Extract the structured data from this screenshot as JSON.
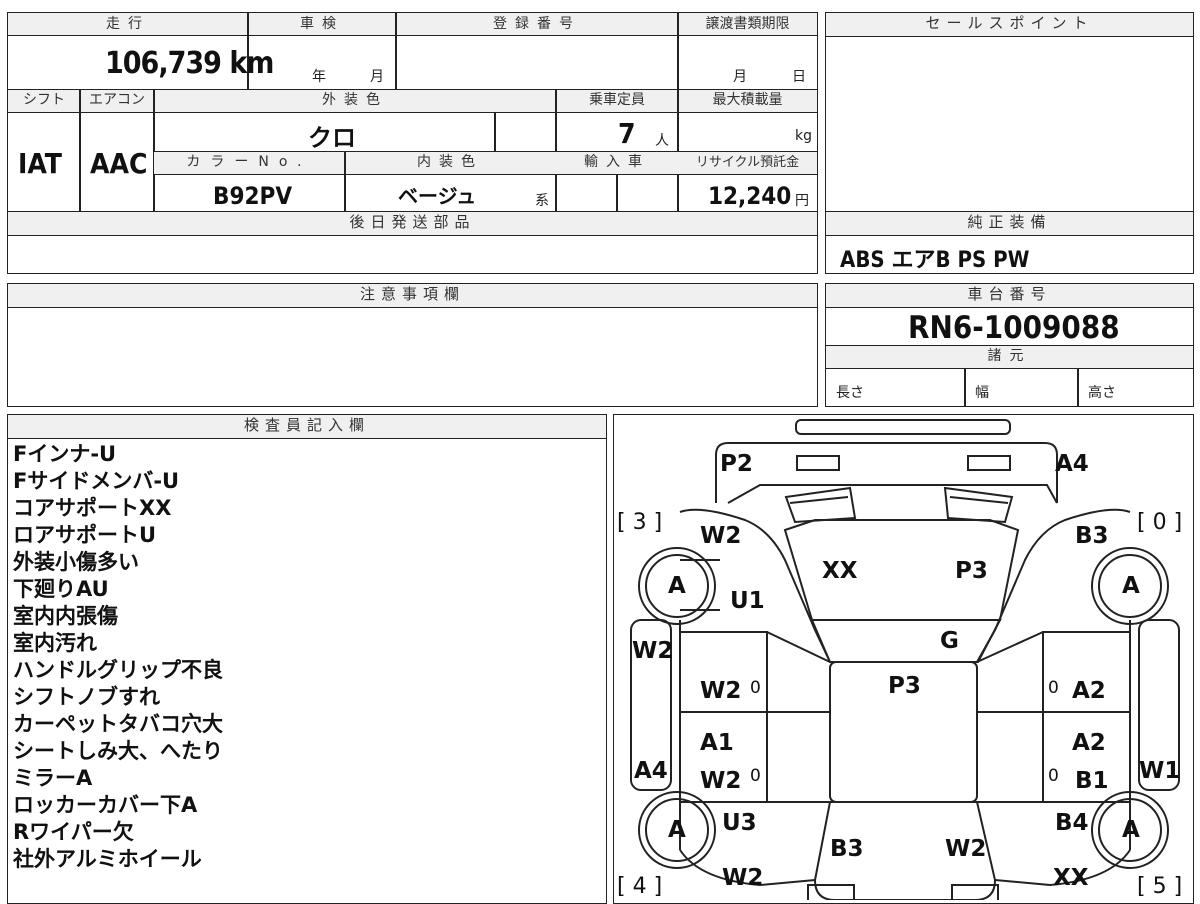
{
  "vehicle_info": {
    "mileage_header": "走行",
    "mileage_value": "106,739 km",
    "shaken_header": "車検",
    "shaken_year": "年",
    "shaken_month": "月",
    "registration_header": "登録番号",
    "transfer_deadline_header": "譲渡書類期限",
    "transfer_month": "月",
    "transfer_day": "日",
    "shift_header": "シフト",
    "shift_value": "IAT",
    "aircon_header": "エアコン",
    "aircon_value": "AAC",
    "exterior_color_header": "外装色",
    "exterior_color_value": "クロ",
    "capacity_header": "乗車定員",
    "capacity_value": "7",
    "capacity_unit": "人",
    "max_load_header": "最大積載量",
    "max_load_unit": "kg",
    "color_no_header": "カラーNo.",
    "color_no_value": "B92PV",
    "interior_color_header": "内装色",
    "interior_color_value": "ベージュ",
    "interior_color_suffix": "系",
    "import_header": "輸入車",
    "recycle_header": "リサイクル預託金",
    "recycle_value": "12,240",
    "recycle_unit": "円",
    "later_parts_header": "後日発送部品"
  },
  "sales_point": {
    "header": "セールスポイント"
  },
  "genuine_equipment": {
    "header": "純正装備",
    "value": "ABS エアB PS PW"
  },
  "notes": {
    "header": "注意事項欄"
  },
  "chassis": {
    "header": "車台番号",
    "value": "RN6-1009088"
  },
  "specs": {
    "header": "諸元",
    "length": "長さ",
    "width": "幅",
    "height": "高さ"
  },
  "inspector": {
    "header": "検査員記入欄",
    "remarks": [
      "Fインナ-U",
      "Fサイドメンバ-U",
      "コアサポートXX",
      "ロアサポートU",
      "外装小傷多い",
      "下廻りAU",
      "室内内張傷",
      "室内汚れ",
      "ハンドルグリップ不良",
      "シフトノブすれ",
      "カーペットタバコ穴大",
      "シートしみ大、へたり",
      "ミラーA",
      "ロッカーカバー下A",
      "Rワイパー欠",
      "社外アルミホイール"
    ]
  },
  "damage_map": {
    "labels": {
      "front_left_corner": "P2",
      "front_right_corner": "A4",
      "bracket_front_left": "[ 3 ]",
      "bracket_front_right": "[ 0 ]",
      "bracket_rear_left": "[ 4 ]",
      "bracket_rear_right": "[ 5 ]",
      "left_front_fender": "W2",
      "right_front_fender": "B3",
      "hood_left": "XX",
      "hood_right": "P3",
      "left_front_fender_lower": "U1",
      "windshield": "G",
      "roof": "P3",
      "left_front_pillar": "W2",
      "left_front_door": "W2",
      "right_front_door": "A2",
      "left_rear_door_top": "A1",
      "left_rear_door": "W2",
      "right_rear_door_top": "A2",
      "right_rear_door": "B1",
      "left_rocker": "A4",
      "right_rocker": "W1",
      "left_rear_fender": "U3",
      "right_rear_fender": "B4",
      "trunk_left": "B3",
      "trunk_right": "W2",
      "left_rear_corner": "W2",
      "right_rear_corner": "XX",
      "left_front_door_zero": "0",
      "right_front_door_zero": "0",
      "left_rear_door_zero": "0",
      "right_rear_door_zero": "0",
      "wheel_front_left": "A",
      "wheel_front_right": "A",
      "wheel_rear_left": "A",
      "wheel_rear_right": "A"
    }
  }
}
